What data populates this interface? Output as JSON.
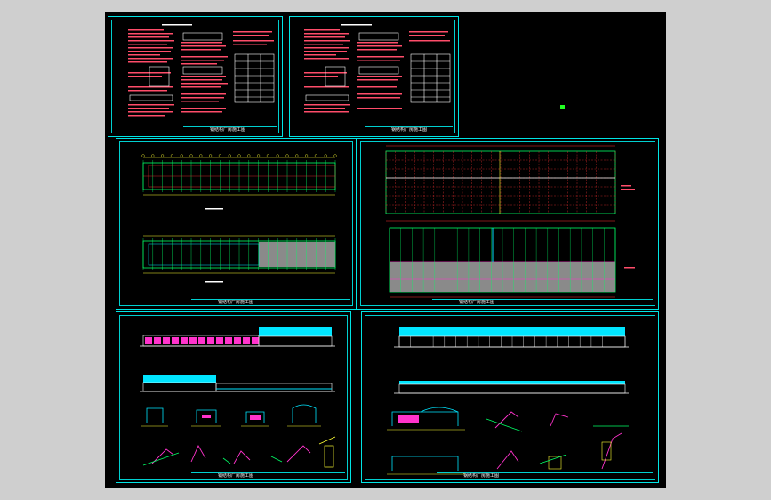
{
  "drawing": {
    "sheet_title": "钢结构厂房施工图",
    "sheet_titles": [
      "钢结构厂房施工图",
      "钢结构厂房施工图",
      "钢结构厂房施工图",
      "钢结构厂房施工图",
      "钢结构厂房施工图",
      "钢结构厂房施工图"
    ]
  },
  "colors": {
    "background": "#000000",
    "border": "#00e5e5",
    "text": "#ff4d6a",
    "grid": "#00ff66",
    "axis": "#ff3333",
    "fill_gray": "#8a8a8a",
    "fill_cyan": "#00e5ff",
    "fill_magenta": "#ff33cc",
    "dim_yellow": "#ffff33"
  },
  "icons": [
    "grip-handle-icon"
  ]
}
